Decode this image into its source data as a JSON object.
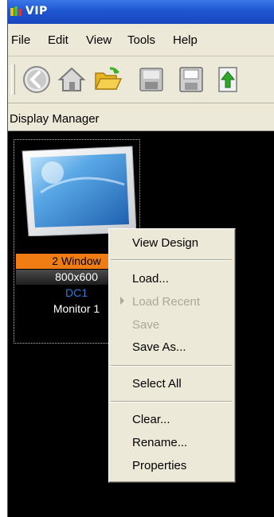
{
  "app": {
    "title": "VIP"
  },
  "menubar": {
    "items": [
      "File",
      "Edit",
      "View",
      "Tools",
      "Help"
    ]
  },
  "toolbar": {
    "buttons": [
      "back-icon",
      "home-icon",
      "open-folder-icon",
      "disk-image-icon",
      "save-icon",
      "export-icon"
    ]
  },
  "panel": {
    "title": "Display Manager"
  },
  "display_tile": {
    "windows_label": "2 Window",
    "resolution": "800x600",
    "dc_label": "DC1",
    "monitor_label": "Monitor 1"
  },
  "context_menu": {
    "view_design": "View Design",
    "load": "Load...",
    "load_recent": "Load Recent",
    "save": "Save",
    "save_as": "Save As...",
    "select_all": "Select All",
    "clear": "Clear...",
    "rename": "Rename...",
    "properties": "Properties"
  },
  "colors": {
    "titlebar": "#245edb",
    "badge": "#f07c14",
    "dc_text": "#2f78d8",
    "menu_bg": "#ece9d8"
  }
}
